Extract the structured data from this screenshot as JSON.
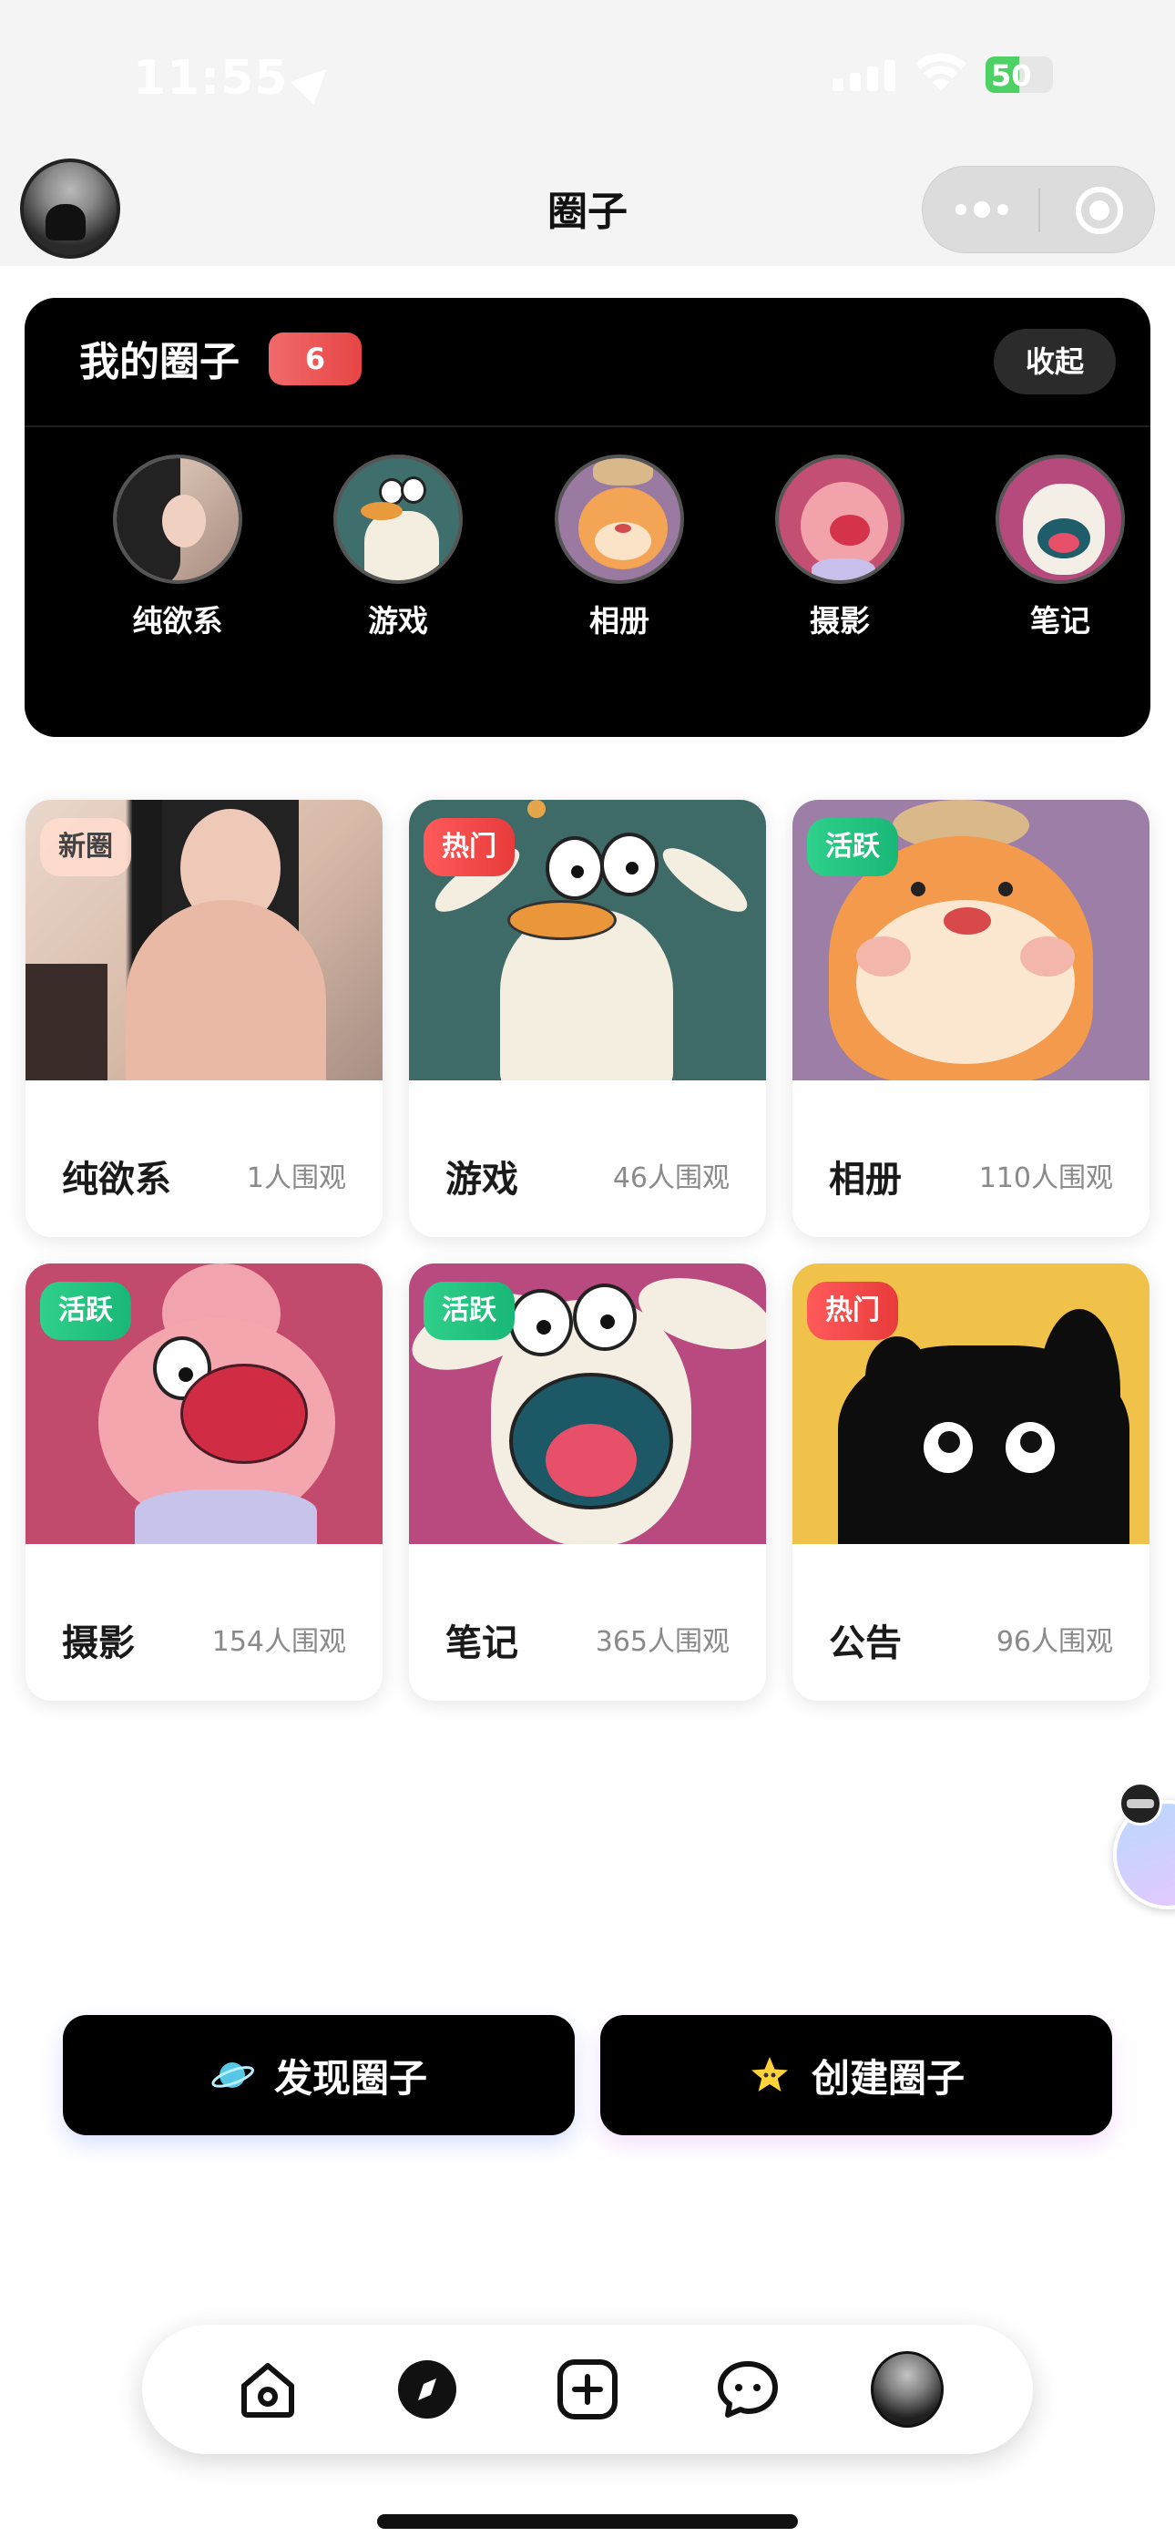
{
  "status_bar": {
    "time": "11:55",
    "battery": "50",
    "battery_level": 0.5
  },
  "nav": {
    "title": "圈子"
  },
  "my_circles": {
    "title": "我的圈子",
    "count": "6",
    "collapse_label": "收起",
    "items": [
      {
        "name": "纯欲系",
        "icon": "girl-photo"
      },
      {
        "name": "游戏",
        "icon": "duck-cartoon"
      },
      {
        "name": "相册",
        "icon": "tiger-cartoon"
      },
      {
        "name": "摄影",
        "icon": "pig-cartoon"
      },
      {
        "name": "笔记",
        "icon": "rabbit-cartoon"
      }
    ]
  },
  "cards": [
    {
      "tag": "新圈",
      "name": "纯欲系",
      "views": "1人围观"
    },
    {
      "tag": "热门",
      "name": "游戏",
      "views": "46人围观"
    },
    {
      "tag": "活跃",
      "name": "相册",
      "views": "110人围观"
    },
    {
      "tag": "活跃",
      "name": "摄影",
      "views": "154人围观"
    },
    {
      "tag": "活跃",
      "name": "笔记",
      "views": "365人围观"
    },
    {
      "tag": "热门",
      "name": "公告",
      "views": "96人围观"
    }
  ],
  "actions": {
    "discover_label": "发现圈子",
    "create_label": "创建圈子"
  },
  "tabbar": {
    "items": [
      "home-icon",
      "compass-icon",
      "add-icon",
      "chat-icon",
      "profile-avatar"
    ]
  },
  "colors": {
    "accent_red": "#e84545",
    "tag_hot": "#ff5a5a",
    "tag_active": "#19b776",
    "panel_bg": "#000000"
  }
}
